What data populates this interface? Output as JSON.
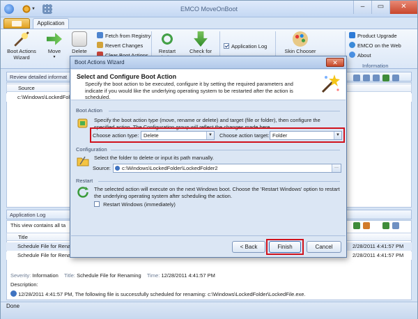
{
  "window": {
    "title": "EMCO MoveOnBoot",
    "min": "–",
    "max": "▭",
    "close": "✕"
  },
  "ribbon": {
    "tab_application": "Application",
    "boot_actions_wizard": "Boot Actions Wizard",
    "move": "Move",
    "delete": "Delete",
    "fetch_from_registry": "Fetch from Registry",
    "revert_changes": "Revert Changes",
    "clear_boot_actions": "Clear Boot Actions",
    "restart_windows": "Restart Windows",
    "check_for_updates": "Check for Updates",
    "application_log": "Application Log",
    "skin_chooser": "Skin Chooser",
    "product_upgrade": "Product Upgrade",
    "emco_on_the_web": "EMCO on the Web",
    "about": "About",
    "group_information": "Information"
  },
  "main": {
    "review_title": "Review detailed informat",
    "col_source": "Source",
    "row1_path": "c:\\Windows\\LockedFold"
  },
  "log": {
    "title": "Application Log",
    "desc": "This view contains all ta",
    "col_title": "Title",
    "row1_title": "Schedule File for Rena",
    "row1_time": "2/28/2011 4:41:57 PM",
    "row2_title": "Schedule File for Rena",
    "row2_time": "2/28/2011 4:41:57 PM"
  },
  "details": {
    "severity_label": "Severity:",
    "severity_value": "Information",
    "title_label": "Title:",
    "title_value": "Schedule File for Renaming",
    "time_label": "Time:",
    "time_value": "12/28/2011 4:41:57 PM",
    "description_label": "Description:",
    "description_time": "12/28/2011 4:41:57 PM,",
    "description_text": "The following file is successfully scheduled for renaming: c:\\Windows\\LockedFolder\\LockedFile.exe."
  },
  "status": {
    "text": "Done"
  },
  "dialog": {
    "title": "Boot Actions Wizard",
    "close": "✕",
    "header_title": "Select and Configure Boot Action",
    "header_subtitle": "Specify the boot action to be executed, configure it by setting the required parameters and indicate if you would like the underlying operating system to be restarted after the action is scheduled.",
    "boot_action": {
      "label": "Boot Action",
      "text": "Specify the boot action type (move, rename or delete) and target (file or folder), then configure the specified action. The Configuration group will reflect the changes made here.",
      "type_label": "Choose action type:",
      "type_value": "Delete",
      "target_label": "Choose action target:",
      "target_value": "Folder"
    },
    "configuration": {
      "label": "Configuration",
      "text": "Select the folder to delete or input its path manually.",
      "source_label": "Source:",
      "source_value": "c:\\Windows\\LockedFolder\\LockedFolder2",
      "browse": "···"
    },
    "restart": {
      "label": "Restart",
      "text": "The selected action will execute on the next Windows boot. Choose the 'Restart Windows' option to restart the underlying operating system after scheduling the action.",
      "checkbox_label": "Restart Windows (immediately)"
    },
    "buttons": {
      "back": "< Back",
      "finish": "Finish",
      "cancel": "Cancel"
    }
  },
  "colors": {
    "highlight": "#d0111b",
    "ribbon_bg": "#dbe7f7",
    "accent": "#2c6fcf"
  }
}
